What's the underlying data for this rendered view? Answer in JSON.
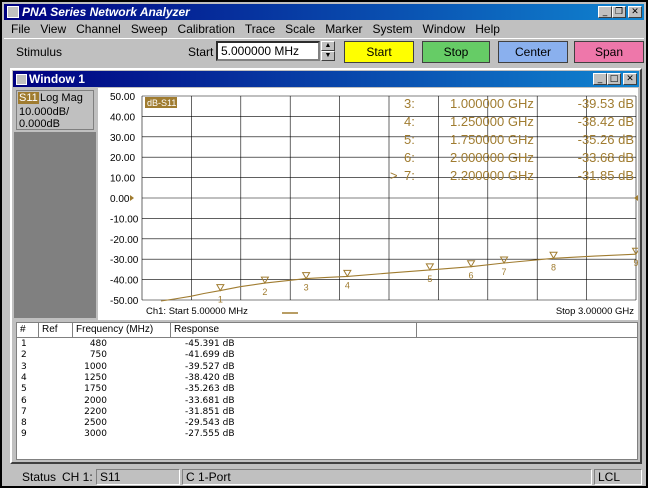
{
  "app": {
    "title": "PNA Series Network Analyzer"
  },
  "menu": [
    "File",
    "View",
    "Channel",
    "Sweep",
    "Calibration",
    "Trace",
    "Scale",
    "Marker",
    "System",
    "Window",
    "Help"
  ],
  "toolbar": {
    "stimulus_label": "Stimulus",
    "start_label": "Start",
    "start_value": "5.000000 MHz",
    "buttons": {
      "start": "Start",
      "stop": "Stop",
      "center": "Center",
      "span": "Span"
    }
  },
  "window": {
    "title": "Window 1",
    "channel_info": {
      "trace": "S11",
      "format": "Log Mag",
      "scale": "10.000dB/",
      "ref": "0.000dB"
    },
    "plot": {
      "trace_label": "dB-S11",
      "footer_left": "Ch1: Start  5.00000 MHz",
      "footer_right": "Stop  3.00000 GHz",
      "marker_readouts": [
        {
          "prefix": "",
          "num": "3:",
          "freq": "1.000000 GHz",
          "val": "-39.53 dB"
        },
        {
          "prefix": "",
          "num": "4:",
          "freq": "1.250000 GHz",
          "val": "-38.42 dB"
        },
        {
          "prefix": "",
          "num": "5:",
          "freq": "1.750000 GHz",
          "val": "-35.26 dB"
        },
        {
          "prefix": "",
          "num": "6:",
          "freq": "2.000000 GHz",
          "val": "-33.68 dB"
        },
        {
          "prefix": ">",
          "num": "7:",
          "freq": "2.200000 GHz",
          "val": "-31.85 dB"
        }
      ]
    },
    "marker_table": {
      "headers": [
        "#",
        "Ref",
        "Frequency (MHz)",
        "Response"
      ],
      "rows": [
        {
          "n": "1",
          "freq": "480",
          "resp": "-45.391 dB"
        },
        {
          "n": "2",
          "freq": "750",
          "resp": "-41.699 dB"
        },
        {
          "n": "3",
          "freq": "1000",
          "resp": "-39.527 dB"
        },
        {
          "n": "4",
          "freq": "1250",
          "resp": "-38.420 dB"
        },
        {
          "n": "5",
          "freq": "1750",
          "resp": "-35.263 dB"
        },
        {
          "n": "6",
          "freq": "2000",
          "resp": "-33.681 dB"
        },
        {
          "n": "7",
          "freq": "2200",
          "resp": "-31.851 dB"
        },
        {
          "n": "8",
          "freq": "2500",
          "resp": "-29.543 dB"
        },
        {
          "n": "9",
          "freq": "3000",
          "resp": "-27.555 dB"
        }
      ]
    }
  },
  "status": {
    "label": "Status",
    "channel": "CH 1:",
    "trace": "S11",
    "port": "C  1-Port",
    "mode": "LCL"
  },
  "chart_data": {
    "type": "line",
    "series": [
      {
        "name": "dB-S11",
        "color": "#a07c30"
      }
    ],
    "x_unit": "MHz",
    "xlim": [
      5,
      3000
    ],
    "ylim": [
      -50,
      50
    ],
    "y_ticks": [
      "50.00",
      "40.00",
      "30.00",
      "20.00",
      "10.00",
      "0.00",
      "-10.00",
      "-20.00",
      "-30.00",
      "-40.00",
      "-50.00"
    ],
    "trace_points": [
      {
        "x": 120,
        "y": -50.5
      },
      {
        "x": 200,
        "y": -49.5
      },
      {
        "x": 300,
        "y": -48.2
      },
      {
        "x": 380,
        "y": -46.8
      },
      {
        "x": 480,
        "y": -45.39
      },
      {
        "x": 600,
        "y": -43.5
      },
      {
        "x": 750,
        "y": -41.7
      },
      {
        "x": 875,
        "y": -40.6
      },
      {
        "x": 1000,
        "y": -39.53
      },
      {
        "x": 1125,
        "y": -38.9
      },
      {
        "x": 1250,
        "y": -38.42
      },
      {
        "x": 1500,
        "y": -36.8
      },
      {
        "x": 1750,
        "y": -35.26
      },
      {
        "x": 2000,
        "y": -33.68
      },
      {
        "x": 2200,
        "y": -31.85
      },
      {
        "x": 2500,
        "y": -29.54
      },
      {
        "x": 2750,
        "y": -28.5
      },
      {
        "x": 3000,
        "y": -27.56
      }
    ],
    "markers": [
      {
        "label": "1",
        "x": 480,
        "y": -45.391
      },
      {
        "label": "2",
        "x": 750,
        "y": -41.699
      },
      {
        "label": "3",
        "x": 1000,
        "y": -39.527
      },
      {
        "label": "4",
        "x": 1250,
        "y": -38.42
      },
      {
        "label": "5",
        "x": 1750,
        "y": -35.263
      },
      {
        "label": "6",
        "x": 2000,
        "y": -33.681
      },
      {
        "label": "7",
        "x": 2200,
        "y": -31.851
      },
      {
        "label": "8",
        "x": 2500,
        "y": -29.543
      },
      {
        "label": "9",
        "x": 3000,
        "y": -27.555
      }
    ]
  }
}
